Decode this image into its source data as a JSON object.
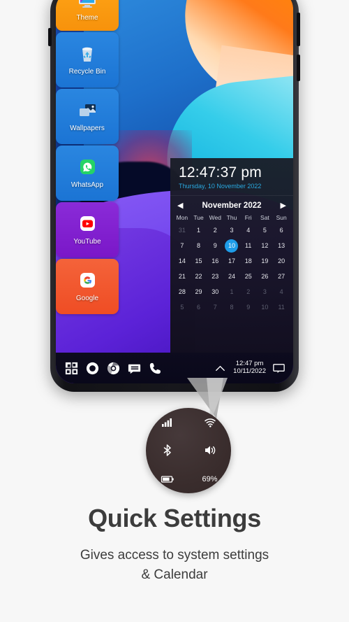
{
  "tiles": [
    {
      "label": "Theme",
      "icon": "monitor-icon",
      "color": "#ffa516"
    },
    {
      "label": "Recycle Bin",
      "icon": "recycle-bin-icon",
      "color": "#2a86e0"
    },
    {
      "label": "Wallpapers",
      "icon": "wallpapers-icon",
      "color": "#2a86e0"
    },
    {
      "label": "WhatsApp",
      "icon": "whatsapp-icon",
      "color": "#2a86e0"
    },
    {
      "label": "YouTube",
      "icon": "youtube-icon",
      "color": "#8a2bd8"
    },
    {
      "label": "Google",
      "icon": "google-icon",
      "color": "#f4633a"
    }
  ],
  "widget": {
    "time": "12:47:37 pm",
    "date": "Thursday, 10 November 2022",
    "prev_arrow": "◀",
    "next_arrow": "▶",
    "month_title": "November 2022",
    "dows": [
      "Mon",
      "Tue",
      "Wed",
      "Thu",
      "Fri",
      "Sat",
      "Sun"
    ],
    "selected_day": "10",
    "selected_color": "#1e9ce8",
    "weeks": [
      [
        {
          "d": "31",
          "dim": true
        },
        {
          "d": "1"
        },
        {
          "d": "2"
        },
        {
          "d": "3"
        },
        {
          "d": "4"
        },
        {
          "d": "5"
        },
        {
          "d": "6"
        }
      ],
      [
        {
          "d": "7"
        },
        {
          "d": "8"
        },
        {
          "d": "9"
        },
        {
          "d": "10",
          "sel": true
        },
        {
          "d": "11"
        },
        {
          "d": "12"
        },
        {
          "d": "13"
        }
      ],
      [
        {
          "d": "14"
        },
        {
          "d": "15"
        },
        {
          "d": "16"
        },
        {
          "d": "17"
        },
        {
          "d": "18"
        },
        {
          "d": "19"
        },
        {
          "d": "20"
        }
      ],
      [
        {
          "d": "21"
        },
        {
          "d": "22"
        },
        {
          "d": "23"
        },
        {
          "d": "24"
        },
        {
          "d": "25"
        },
        {
          "d": "26"
        },
        {
          "d": "27"
        }
      ],
      [
        {
          "d": "28"
        },
        {
          "d": "29"
        },
        {
          "d": "30"
        },
        {
          "d": "1",
          "dim": true
        },
        {
          "d": "2",
          "dim": true
        },
        {
          "d": "3",
          "dim": true
        },
        {
          "d": "4",
          "dim": true
        }
      ],
      [
        {
          "d": "5",
          "dim": true
        },
        {
          "d": "6",
          "dim": true
        },
        {
          "d": "7",
          "dim": true
        },
        {
          "d": "8",
          "dim": true
        },
        {
          "d": "9",
          "dim": true
        },
        {
          "d": "10",
          "dim": true
        },
        {
          "d": "11",
          "dim": true
        }
      ]
    ]
  },
  "taskbar": {
    "icons": [
      "start-icon",
      "cortana-icon",
      "chrome-icon",
      "messages-icon",
      "phone-icon"
    ],
    "tray_chevron": "chevron-up-icon",
    "time": "12:47 pm",
    "date": "10/11/2022",
    "action_center": "action-center-icon"
  },
  "quick_settings": {
    "items": [
      "signal-icon",
      "wifi-icon",
      "bluetooth-icon",
      "volume-icon",
      "battery-icon"
    ],
    "battery_percent": "69%"
  },
  "caption": {
    "title": "Quick Settings",
    "subtitle_line1": "Gives access to system settings",
    "subtitle_line2": "& Calendar"
  }
}
